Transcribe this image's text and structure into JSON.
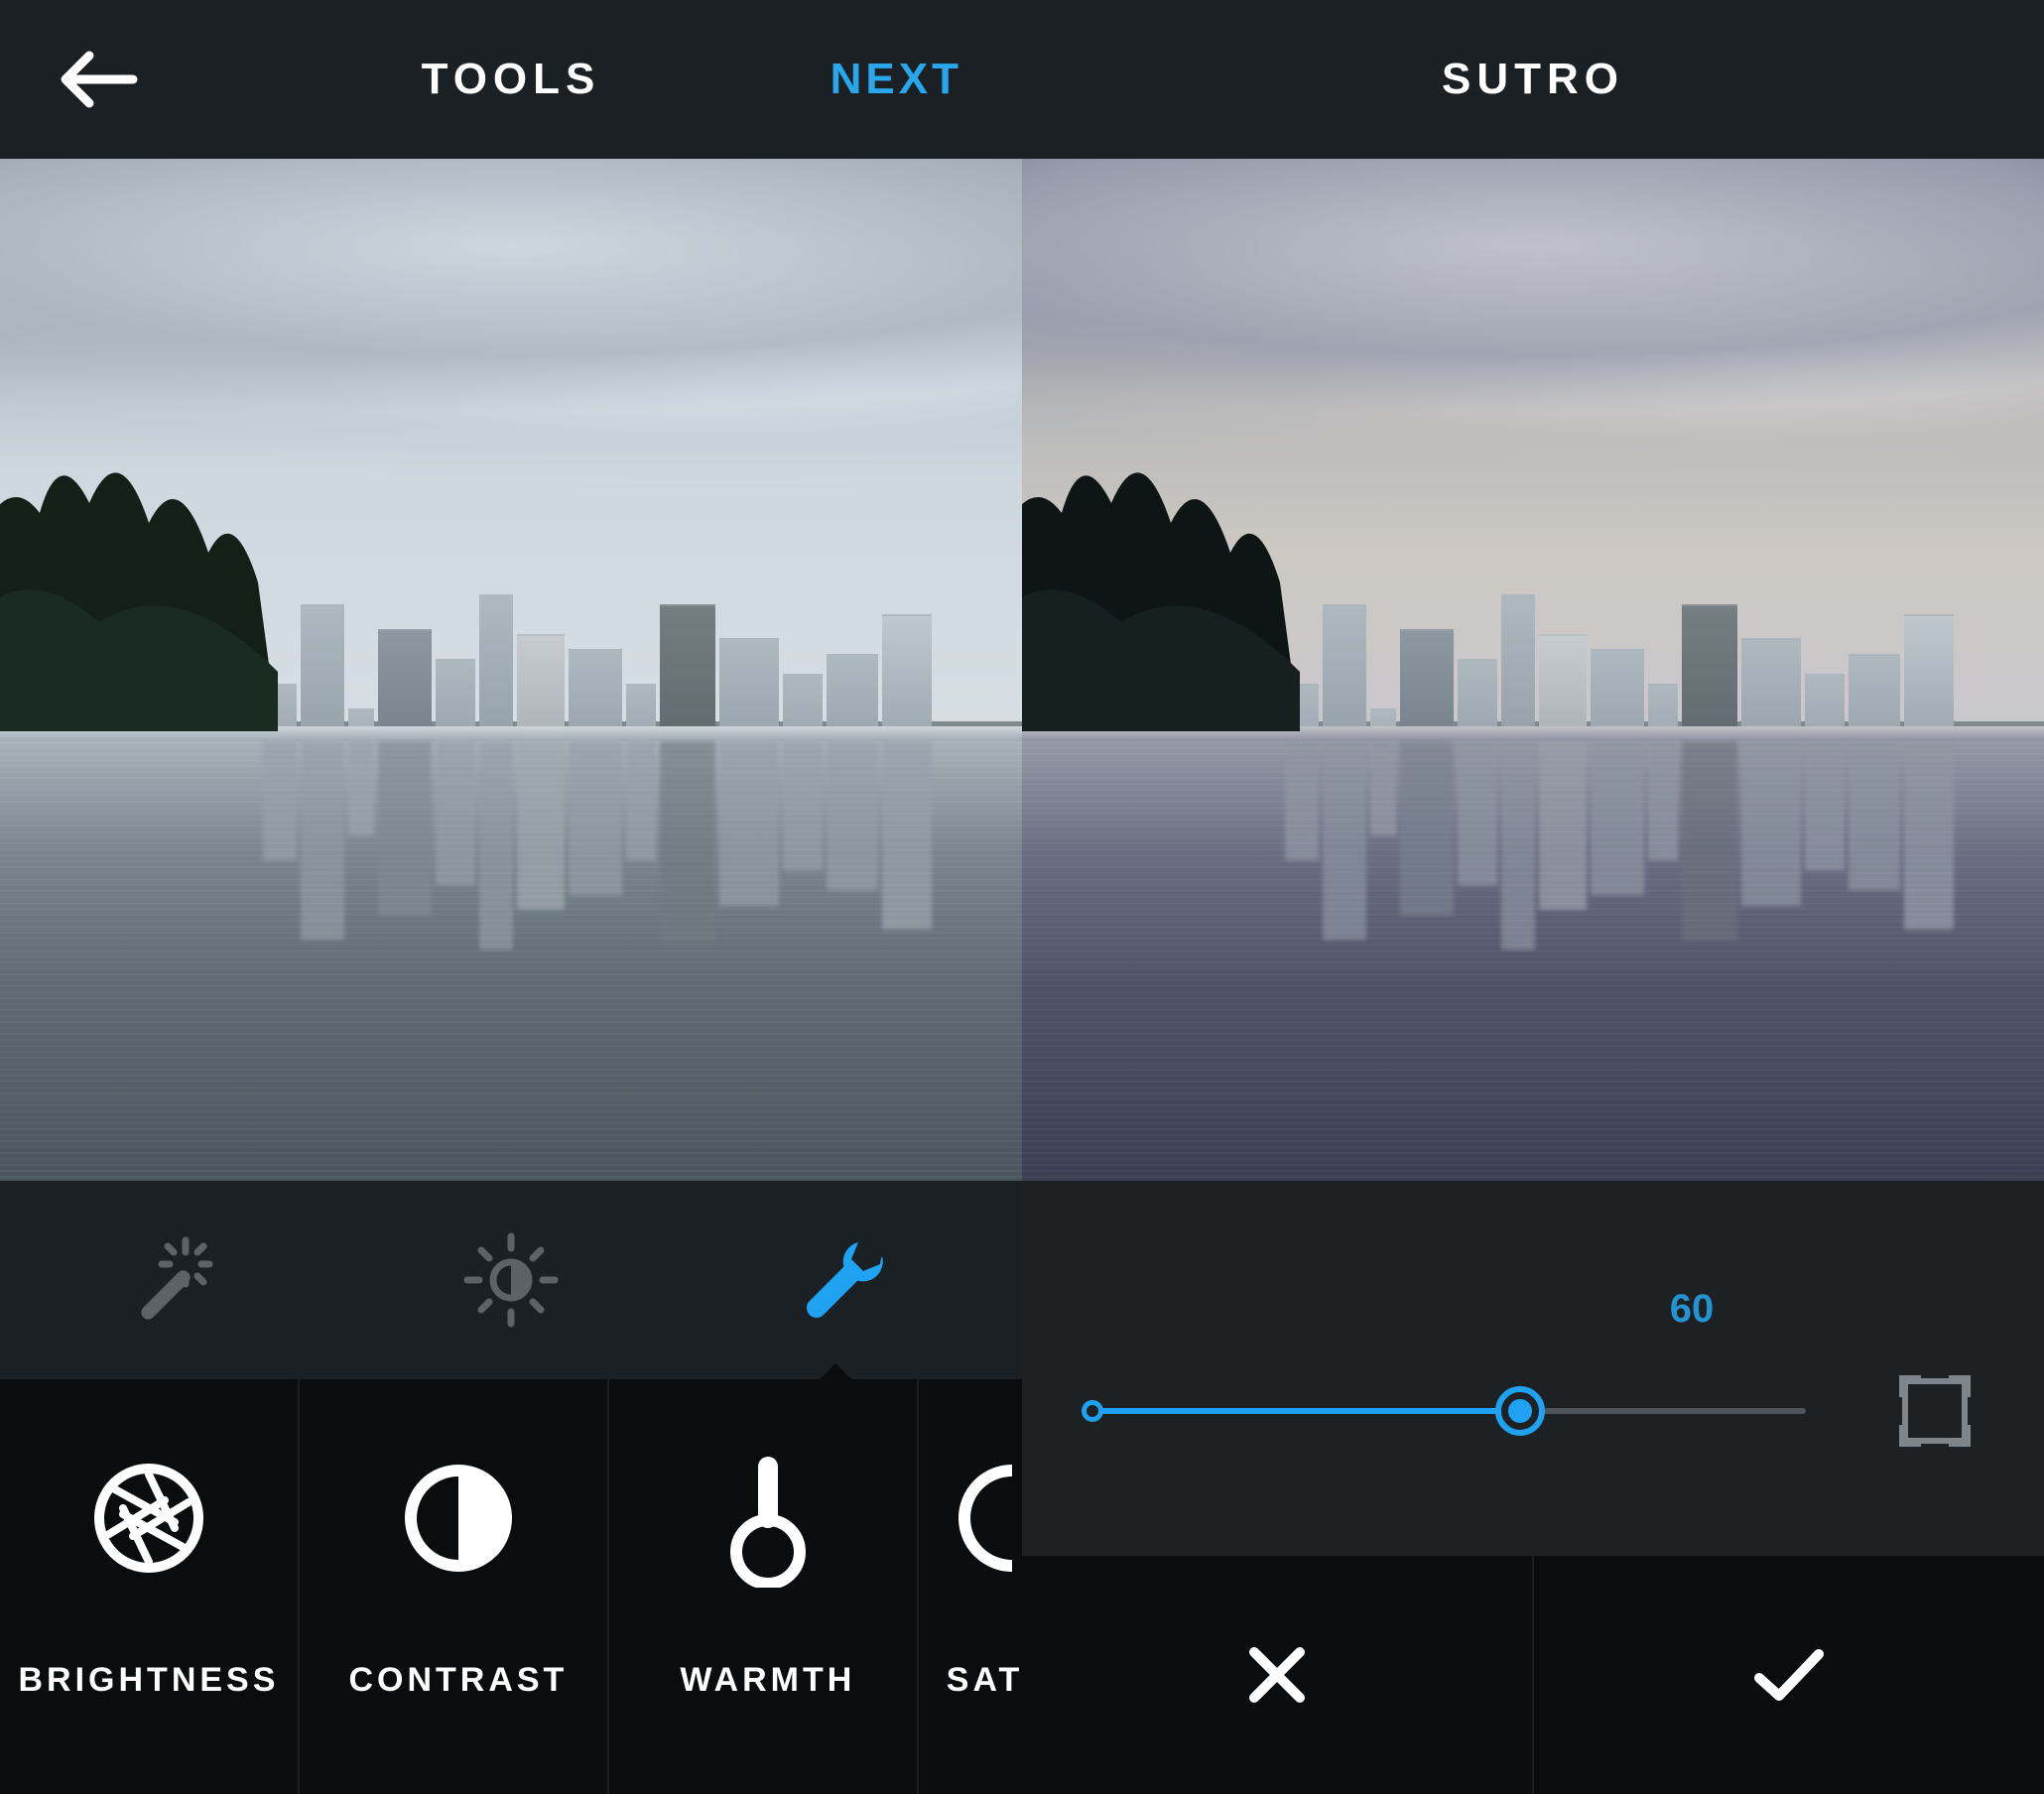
{
  "left": {
    "header": {
      "title": "TOOLS",
      "next_label": "NEXT"
    },
    "tabs": {
      "icons": [
        "magic-wand-icon",
        "auto-enhance-sun-icon",
        "wrench-icon"
      ],
      "active_index": 2
    },
    "tools": [
      {
        "icon": "aperture-icon",
        "label": "BRIGHTNESS"
      },
      {
        "icon": "contrast-icon",
        "label": "CONTRAST"
      },
      {
        "icon": "thermometer-icon",
        "label": "WARMTH"
      },
      {
        "icon": "saturation-icon",
        "label": "SATU"
      }
    ]
  },
  "right": {
    "header": {
      "title": "SUTRO"
    },
    "slider": {
      "value": 60,
      "min": 0,
      "max": 100,
      "frame_enabled": false
    },
    "actions": {
      "cancel": "cancel",
      "confirm": "confirm"
    }
  },
  "colors": {
    "accent": "#1ea2f1",
    "bg_dark": "#0a0c0d",
    "bg_panel": "#1b2024"
  }
}
